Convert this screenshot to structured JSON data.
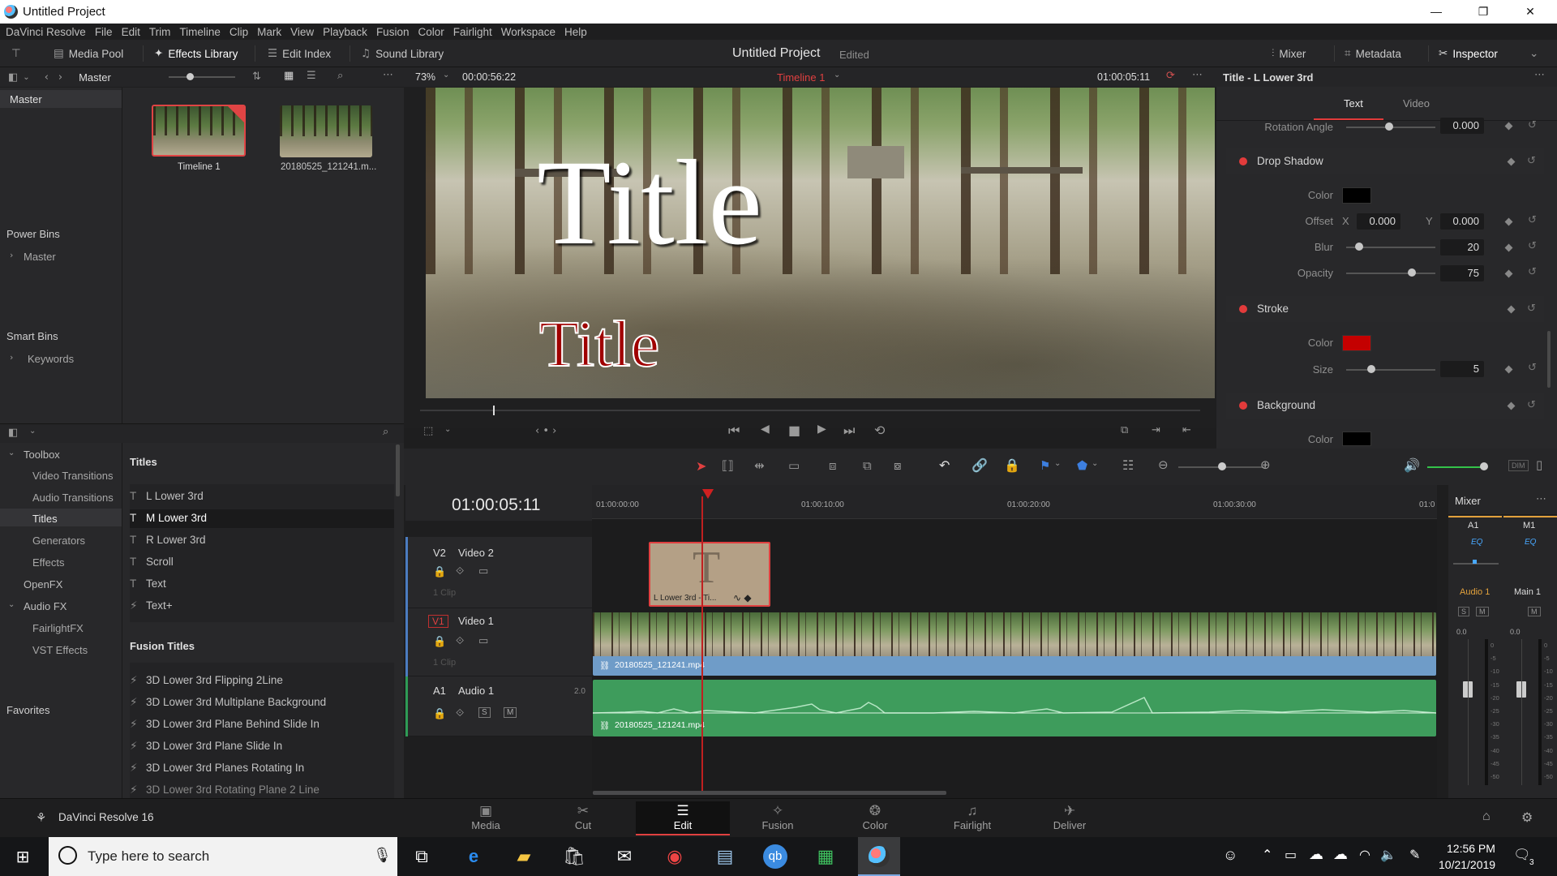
{
  "window": {
    "title": "Untitled Project"
  },
  "menu": [
    "DaVinci Resolve",
    "File",
    "Edit",
    "Trim",
    "Timeline",
    "Clip",
    "Mark",
    "View",
    "Playback",
    "Fusion",
    "Color",
    "Fairlight",
    "Workspace",
    "Help"
  ],
  "toolbar": {
    "media_pool": "Media Pool",
    "effects_library": "Effects Library",
    "edit_index": "Edit Index",
    "sound_library": "Sound Library",
    "project_name": "Untitled Project",
    "project_status": "Edited",
    "mixer": "Mixer",
    "metadata": "Metadata",
    "inspector": "Inspector"
  },
  "media_pool": {
    "bin_name": "Master",
    "clips": [
      {
        "label": "Timeline 1"
      },
      {
        "label": "20180525_121241.m..."
      }
    ],
    "master_label": "Master",
    "power_bins": "Power Bins",
    "power_bins_master": "Master",
    "smart_bins": "Smart Bins",
    "keywords": "Keywords"
  },
  "viewer": {
    "zoom": "73%",
    "duration": "00:00:56:22",
    "timeline_name": "Timeline 1",
    "timecode": "01:00:05:11",
    "title_large": "Title",
    "title_small": "Title"
  },
  "inspector": {
    "header": "Title - L Lower 3rd",
    "tabs": [
      "Text",
      "Video"
    ],
    "rotation_angle_label": "Rotation Angle",
    "rotation_angle_value": "0.000",
    "drop_shadow": {
      "title": "Drop Shadow",
      "color_label": "Color",
      "offset_label": "Offset",
      "x_label": "X",
      "x_value": "0.000",
      "y_label": "Y",
      "y_value": "0.000",
      "blur_label": "Blur",
      "blur_value": "20",
      "opacity_label": "Opacity",
      "opacity_value": "75",
      "color": "#000000"
    },
    "stroke": {
      "title": "Stroke",
      "color_label": "Color",
      "size_label": "Size",
      "size_value": "5",
      "color": "#c40000"
    },
    "background": {
      "title": "Background",
      "color_label": "Color",
      "color": "#000000"
    }
  },
  "effects": {
    "toolbox_tree": [
      {
        "label": "Toolbox",
        "level": 0,
        "expanded": true
      },
      {
        "label": "Video Transitions",
        "level": 1
      },
      {
        "label": "Audio Transitions",
        "level": 1
      },
      {
        "label": "Titles",
        "level": 1,
        "selected": true
      },
      {
        "label": "Generators",
        "level": 1
      },
      {
        "label": "Effects",
        "level": 1
      },
      {
        "label": "OpenFX",
        "level": 0
      },
      {
        "label": "Audio FX",
        "level": 0,
        "expanded": true
      },
      {
        "label": "FairlightFX",
        "level": 1
      },
      {
        "label": "VST Effects",
        "level": 1
      }
    ],
    "favorites": "Favorites",
    "titles_header": "Titles",
    "titles": [
      "L Lower 3rd",
      "M Lower 3rd",
      "R Lower 3rd",
      "Scroll",
      "Text",
      "Text+"
    ],
    "fusion_titles_header": "Fusion Titles",
    "fusion_titles": [
      "3D Lower 3rd Flipping 2Line",
      "3D Lower 3rd Multiplane Background",
      "3D Lower 3rd Plane Behind Slide In",
      "3D Lower 3rd Plane Slide In",
      "3D Lower 3rd Planes Rotating In",
      "3D Lower 3rd Rotating Plane 2 Line"
    ]
  },
  "timeline": {
    "timecode": "01:00:05:11",
    "ruler": [
      "01:00:00:00",
      "01:00:10:00",
      "01:00:20:00",
      "01:00:30:00",
      "01:0"
    ],
    "tracks": {
      "v2": {
        "id": "V2",
        "name": "Video 2",
        "clips": "1 Clip"
      },
      "v1": {
        "id": "V1",
        "name": "Video 1",
        "clips": "1 Clip"
      },
      "a1": {
        "id": "A1",
        "name": "Audio 1",
        "level": "2.0",
        "s": "S",
        "m": "M"
      }
    },
    "title_clip": {
      "glyph": "T",
      "label": "L Lower 3rd - Ti..."
    },
    "video_clip": "20180525_121241.mp4",
    "audio_clip": "20180525_121241.mp4"
  },
  "mixer": {
    "title": "Mixer",
    "channels": [
      {
        "id": "A1",
        "eq": "EQ",
        "name": "Audio 1",
        "level": "0.0",
        "s": "S",
        "m": "M"
      },
      {
        "id": "M1",
        "eq": "EQ",
        "name": "Main 1",
        "level": "0.0",
        "m": "M"
      }
    ],
    "scale": [
      "0",
      "-5",
      "-10",
      "-15",
      "-20",
      "-25",
      "-30",
      "-35",
      "-40",
      "-45",
      "-50"
    ],
    "dim": "DIM"
  },
  "pages": {
    "app_name": "DaVinci Resolve 16",
    "tabs": [
      {
        "label": "Media",
        "glyph": "▣"
      },
      {
        "label": "Cut",
        "glyph": "✂"
      },
      {
        "label": "Edit",
        "glyph": "☰",
        "active": true
      },
      {
        "label": "Fusion",
        "glyph": "✧"
      },
      {
        "label": "Color",
        "glyph": "❂"
      },
      {
        "label": "Fairlight",
        "glyph": "♫"
      },
      {
        "label": "Deliver",
        "glyph": "✈"
      }
    ]
  },
  "taskbar": {
    "search_placeholder": "Type here to search",
    "time": "12:56 PM",
    "date": "10/21/2019",
    "notification_count": "3"
  },
  "colors": {
    "accent_red": "#e23b3b",
    "timeline_playhead": "#d02020",
    "video_clip": "#6f9cc8",
    "audio_clip": "#3e9c5c",
    "mixer_accent": "#e2a13c"
  }
}
